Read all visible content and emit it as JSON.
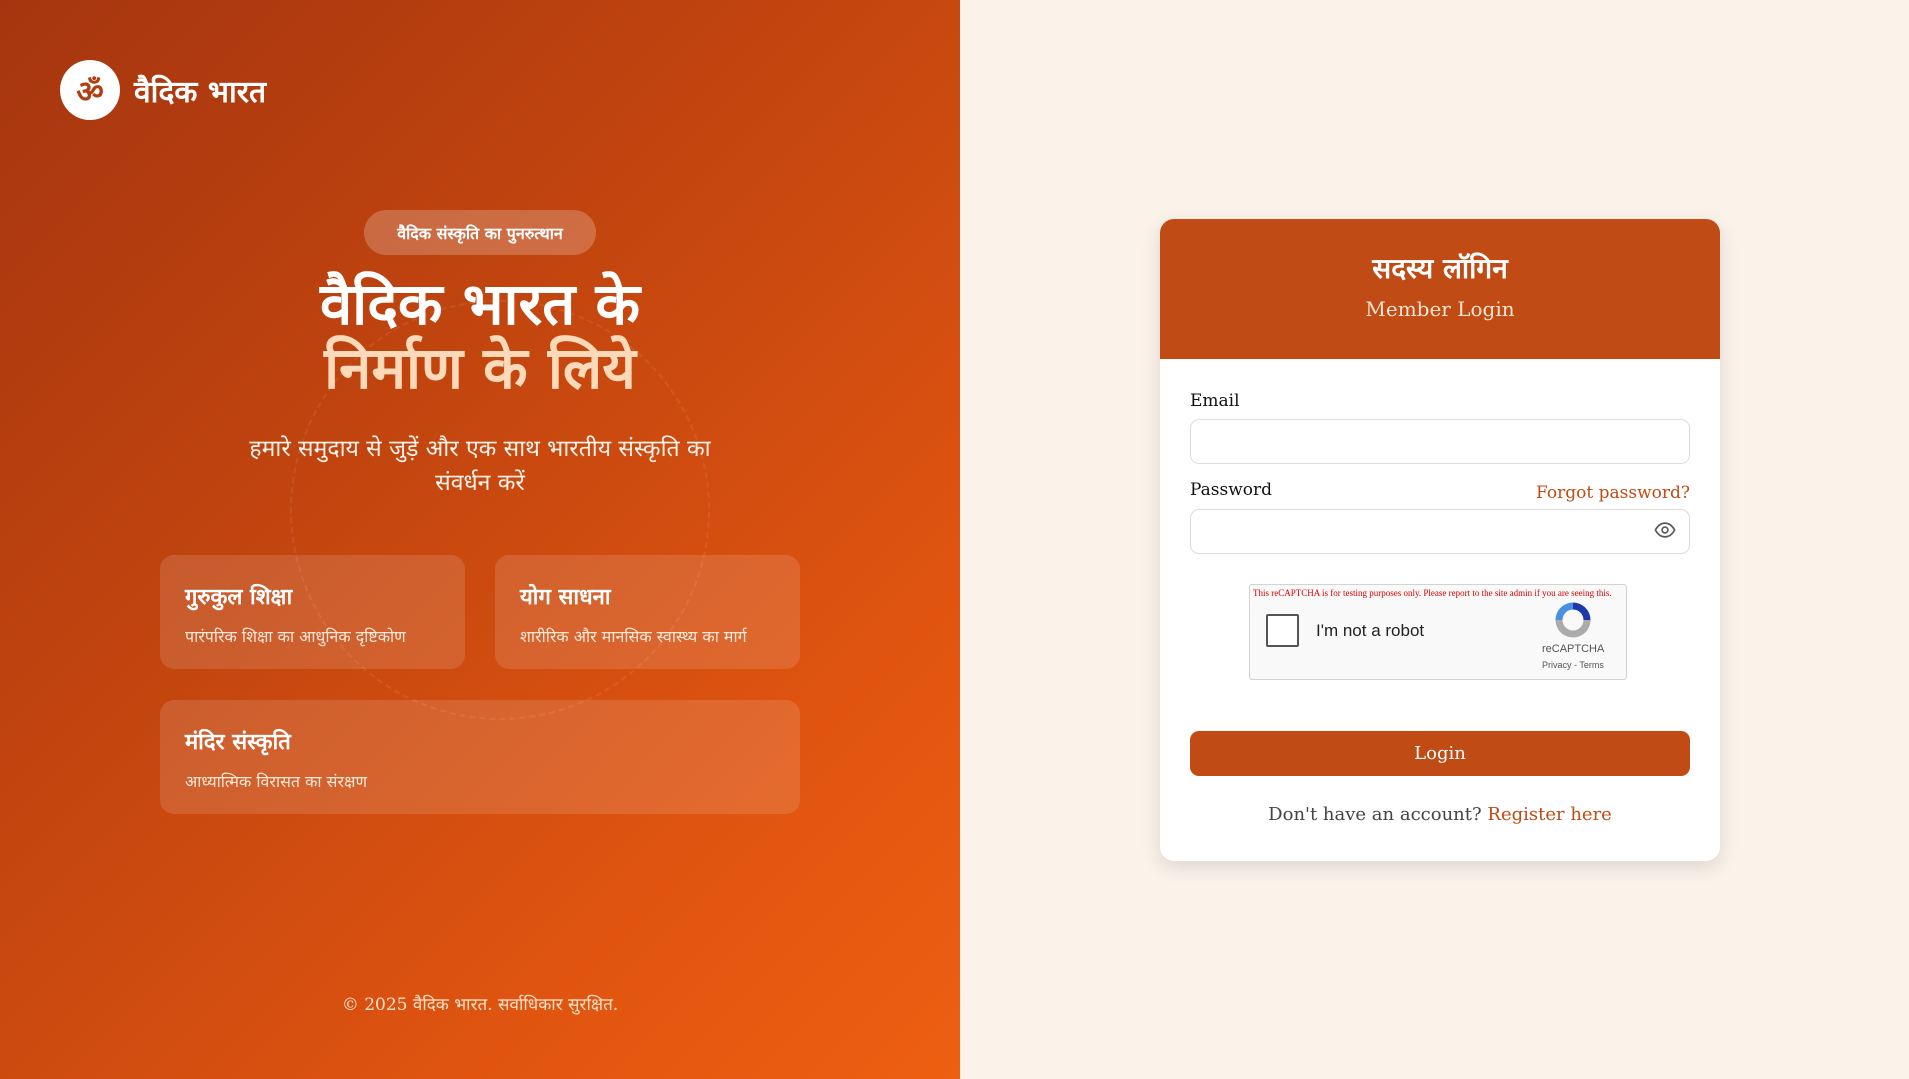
{
  "brand": {
    "logo_symbol": "ॐ",
    "name": "वैदिक भारत"
  },
  "hero": {
    "badge": "वैदिक संस्कृति का पुनरुत्थान",
    "headline_line1": "वैदिक भारत के",
    "headline_line2": "निर्माण के लिये",
    "subtext": "हमारे समुदाय से जुड़ें और एक साथ भारतीय संस्कृति का संवर्धन करें"
  },
  "features": [
    {
      "title": "गुरुकुल शिक्षा",
      "desc": "पारंपरिक शिक्षा का आधुनिक दृष्टिकोण"
    },
    {
      "title": "योग साधना",
      "desc": "शारीरिक और मानसिक स्वास्थ्य का मार्ग"
    },
    {
      "title": "मंदिर संस्कृति",
      "desc": "आध्यात्मिक विरासत का संरक्षण"
    }
  ],
  "footer": {
    "copyright": "© 2025 वैदिक भारत. सर्वाधिकार सुरक्षित."
  },
  "login": {
    "title": "सदस्य लॉगिन",
    "subtitle": "Member Login",
    "email_label": "Email",
    "email_value": "",
    "password_label": "Password",
    "password_value": "",
    "forgot_link": "Forgot password?",
    "button_label": "Login",
    "register_prompt": "Don't have an account?",
    "register_link": "Register here"
  },
  "captcha": {
    "warning": "This reCAPTCHA is for testing purposes only. Please report to the site admin if you are seeing this.",
    "label": "I'm not a robot",
    "brand": "reCAPTCHA",
    "links": "Privacy - Terms"
  },
  "colors": {
    "accent": "#c04b15",
    "page_bg": "#fbf3ea",
    "gradient_start": "#a6350f",
    "gradient_end": "#ee5f11"
  },
  "icons": {
    "logo": "om-icon",
    "password_toggle": "eye-icon",
    "captcha": "recaptcha-logo-icon"
  }
}
